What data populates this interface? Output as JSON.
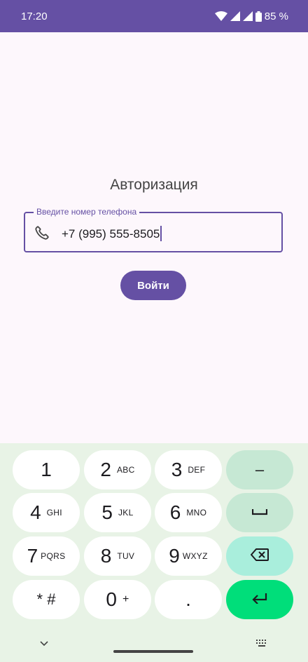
{
  "status_bar": {
    "time": "17:20",
    "battery": "85 %",
    "icons": [
      "wifi-icon",
      "signal-icon",
      "signal-icon",
      "battery-icon"
    ]
  },
  "auth": {
    "title": "Авторизация",
    "phone_label": "Введите номер телефона",
    "phone_value": "+7 (995) 555-8505",
    "login_button": "Войти"
  },
  "keyboard": {
    "keys": [
      {
        "main": "1",
        "sub": ""
      },
      {
        "main": "2",
        "sub": "ABC"
      },
      {
        "main": "3",
        "sub": "DEF"
      },
      {
        "main": "–",
        "sub": ""
      },
      {
        "main": "4",
        "sub": "GHI"
      },
      {
        "main": "5",
        "sub": "JKL"
      },
      {
        "main": "6",
        "sub": "MNO"
      },
      {
        "main": "7",
        "sub": "PQRS"
      },
      {
        "main": "8",
        "sub": "TUV"
      },
      {
        "main": "9",
        "sub": "WXYZ"
      },
      {
        "main": "* #",
        "sub": ""
      },
      {
        "main": "0",
        "sub": "+"
      },
      {
        "main": ".",
        "sub": ""
      }
    ]
  },
  "colors": {
    "accent": "#6550a4",
    "background": "#fdf7fc",
    "keyboard_bg": "#e8f3e6",
    "enter_key": "#00de7a"
  }
}
